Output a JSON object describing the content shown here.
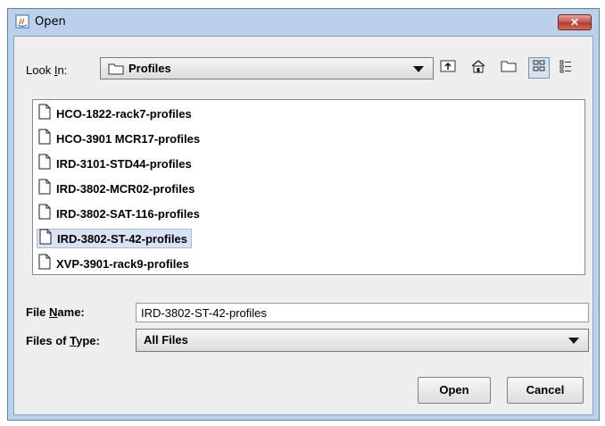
{
  "window": {
    "title": "Open",
    "close_glyph": "✕"
  },
  "look_in": {
    "label_prefix": "Look ",
    "label_mnemonic": "I",
    "label_suffix": "n:",
    "value": "Profiles"
  },
  "toolbar": {
    "icons": [
      "up-one-level-icon",
      "home-icon",
      "new-folder-icon",
      "list-view-icon",
      "details-view-icon"
    ]
  },
  "files": [
    "HCO-1822-rack7-profiles",
    "HCO-3901 MCR17-profiles",
    "IRD-3101-STD44-profiles",
    "IRD-3802-MCR02-profiles",
    "IRD-3802-SAT-116-profiles",
    "IRD-3802-ST-42-profiles",
    "XVP-3901-rack9-profiles"
  ],
  "selected_index": 5,
  "file_name": {
    "label_prefix": "File ",
    "label_mnemonic": "N",
    "label_suffix": "ame:",
    "value": "IRD-3802-ST-42-profiles"
  },
  "file_type": {
    "label_prefix": "Files of ",
    "label_mnemonic": "T",
    "label_suffix": "ype:",
    "value": "All Files"
  },
  "buttons": {
    "open": "Open",
    "cancel": "Cancel"
  },
  "colors": {
    "title_bar": "#b9d1ea",
    "selection": "#dae3f3",
    "close_button": "#c75050"
  }
}
